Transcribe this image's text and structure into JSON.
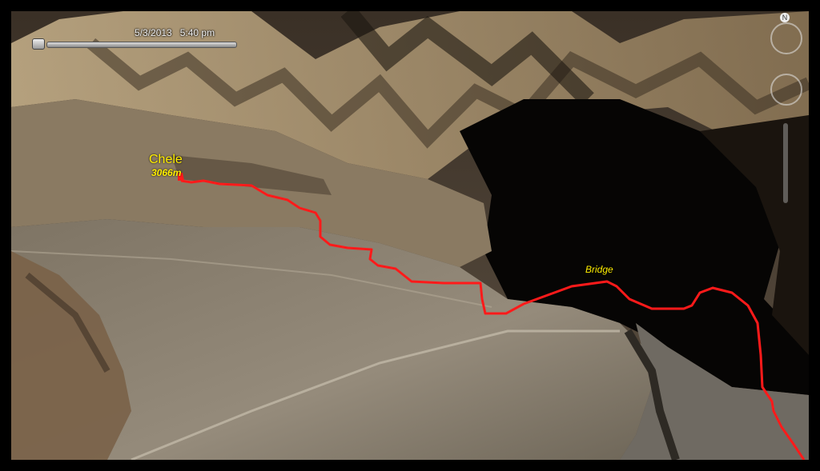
{
  "timeline": {
    "date_time": "5/3/2013   5:40 pm"
  },
  "places": {
    "village": {
      "name": "Chele",
      "elevation": "3066m"
    },
    "bridge": {
      "name": "Bridge"
    }
  },
  "colors": {
    "route": "#ff1a1a",
    "label": "#ffee00"
  },
  "icons": {
    "north": "compass-north-icon",
    "look": "look-around-icon",
    "move": "move-joystick-icon"
  }
}
